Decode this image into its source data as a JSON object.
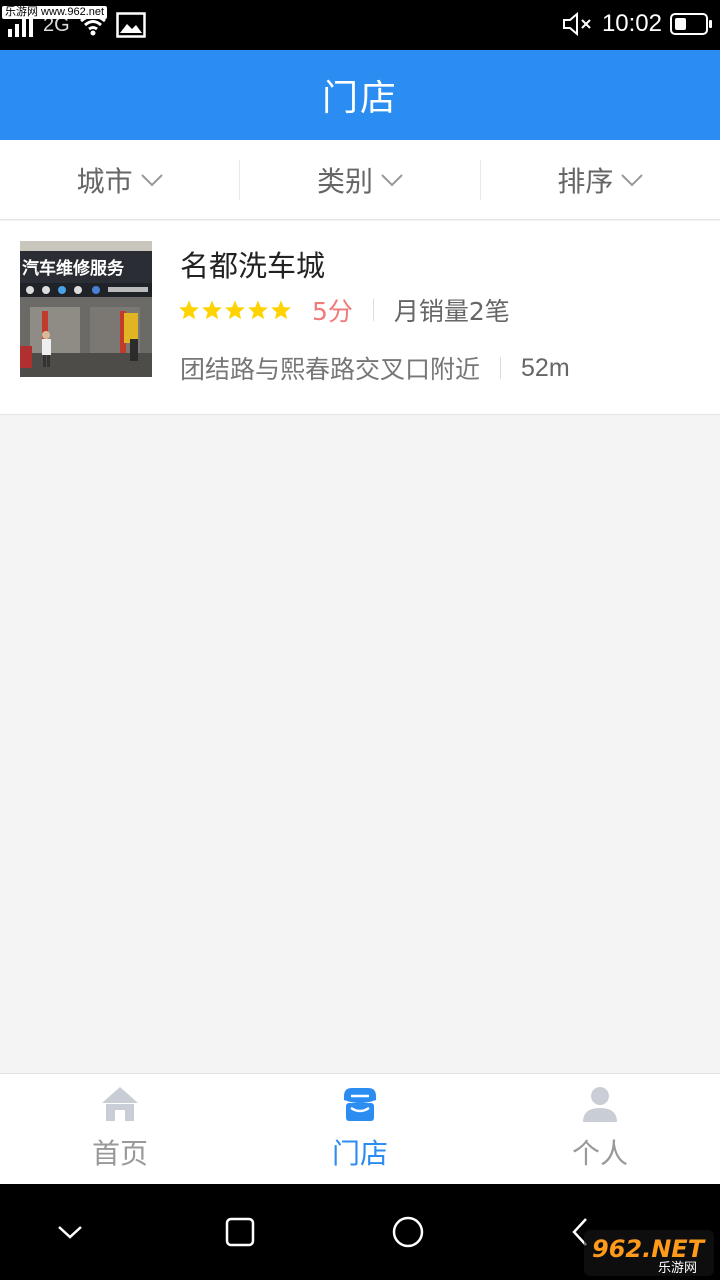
{
  "status_bar": {
    "watermark": "乐游网 www.962.net",
    "network": "2G",
    "time": "10:02",
    "battery_level": 0.4,
    "icons": [
      "signal-icon",
      "wifi-icon",
      "image-icon",
      "mute-icon",
      "battery-icon"
    ]
  },
  "header": {
    "title": "门店"
  },
  "filters": [
    {
      "label": "城市"
    },
    {
      "label": "类别"
    },
    {
      "label": "排序"
    }
  ],
  "store": {
    "name": "名都洗车城",
    "rating_stars": 5,
    "score": "5分",
    "sales": "月销量2笔",
    "address": "团结路与熙春路交叉口附近",
    "distance": "52m",
    "photo_sign_text": "汽车维修服务"
  },
  "tabs": [
    {
      "label": "首页",
      "icon": "home-icon",
      "active": false
    },
    {
      "label": "门店",
      "icon": "store-icon",
      "active": true
    },
    {
      "label": "个人",
      "icon": "person-icon",
      "active": false
    }
  ],
  "nav_icons": [
    "collapse-icon",
    "recent-apps-icon",
    "home-circle-icon",
    "back-icon"
  ],
  "bottom_watermark": {
    "logo": "962.NET",
    "site": "乐游网"
  },
  "colors": {
    "primary": "#2b8cf2",
    "star": "#ffd300",
    "score": "#f07a7a",
    "inactive": "#999999"
  }
}
